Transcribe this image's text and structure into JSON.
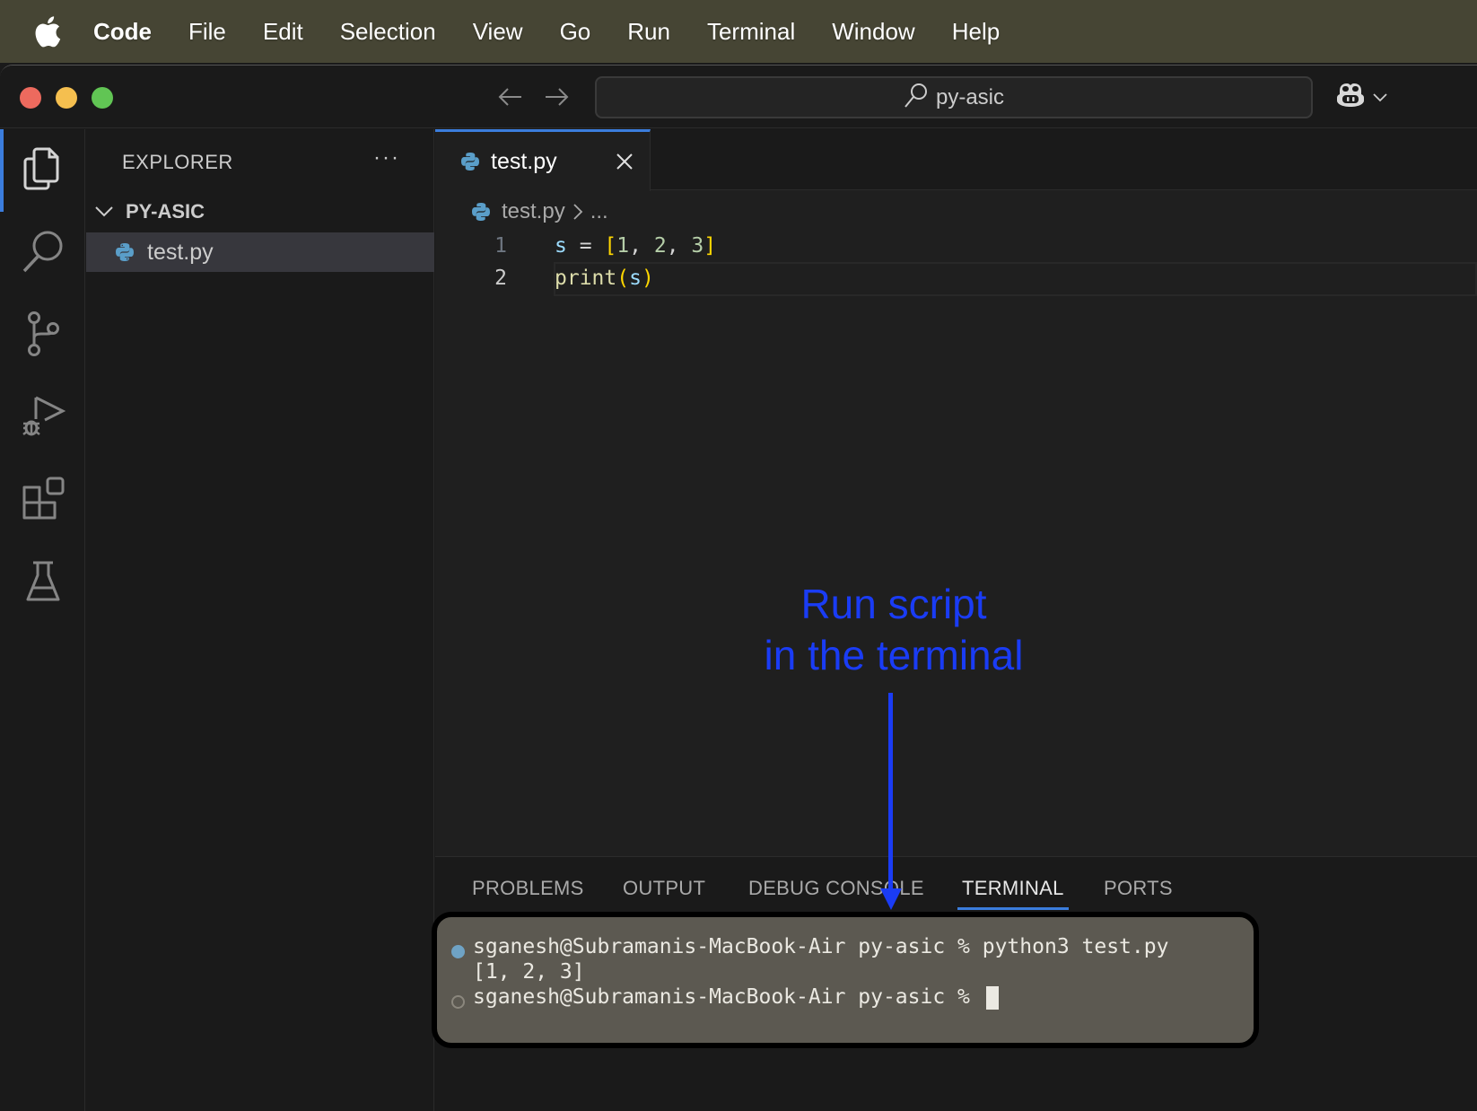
{
  "menubar": {
    "app_name": "Code",
    "items": [
      "File",
      "Edit",
      "Selection",
      "View",
      "Go",
      "Run",
      "Terminal",
      "Window",
      "Help"
    ]
  },
  "titlebar": {
    "search_text": "py-asic"
  },
  "activity_bar": {
    "items": [
      "explorer",
      "search",
      "source-control",
      "run-and-debug",
      "extensions",
      "testing"
    ],
    "active": "explorer"
  },
  "sidebar": {
    "title": "EXPLORER",
    "more_label": "···",
    "folder": "PY-ASIC",
    "files": [
      {
        "name": "test.py",
        "selected": true
      }
    ]
  },
  "editor": {
    "tab": {
      "label": "test.py"
    },
    "breadcrumb": {
      "file": "test.py",
      "rest": "..."
    },
    "lines": [
      {
        "num": "1",
        "text": "s = [1, 2, 3]"
      },
      {
        "num": "2",
        "text": "print(s)"
      }
    ]
  },
  "annotation": {
    "line1": "Run script",
    "line2": "in the terminal",
    "color": "#1a3cf5"
  },
  "panel": {
    "tabs": [
      "PROBLEMS",
      "OUTPUT",
      "DEBUG CONSOLE",
      "TERMINAL",
      "PORTS"
    ],
    "active_tab": "TERMINAL",
    "terminal": {
      "lines": [
        "sganesh@Subramanis-MacBook-Air py-asic % python3 test.py",
        "[1, 2, 3]",
        "sganesh@Subramanis-MacBook-Air py-asic % "
      ]
    }
  },
  "colors": {
    "accent": "#3b7ddd",
    "python_icon": "#5a9ec9"
  }
}
